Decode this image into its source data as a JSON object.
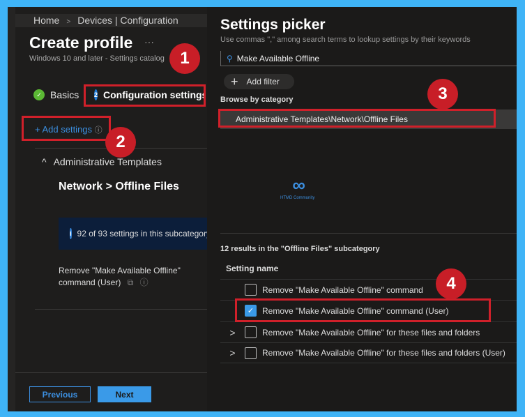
{
  "breadcrumb": [
    "Home",
    "Devices | Configuration"
  ],
  "title": "Create profile",
  "more": "···",
  "subtitle": "Windows 10 and later - Settings catalog",
  "steps": [
    {
      "num": "✓",
      "label": "Basics"
    },
    {
      "num": "2",
      "label": "Configuration settings"
    }
  ],
  "add_settings": "+ Add settings",
  "group": "Administrative Templates",
  "subcategory": "Network > Offline Files",
  "info": "92 of 93 settings in this subcategory",
  "setting_line1": "Remove \"Make Available Offline\"",
  "setting_line2": "command (User)",
  "buttons": {
    "previous": "Previous",
    "next": "Next"
  },
  "picker": {
    "title": "Settings picker",
    "hint": "Use commas \",\" among search terms to lookup settings by their keywords",
    "search_value": "Make Available Offline",
    "add_filter": "Add filter",
    "browse": "Browse by category",
    "category": "Administrative Templates\\Network\\Offline Files",
    "results": "12 results in the \"Offline Files\" subcategory",
    "column": "Setting name",
    "rows": [
      {
        "label": "Remove \"Make Available Offline\" command",
        "checked": false
      },
      {
        "label": "Remove \"Make Available Offline\" command (User)",
        "checked": true
      },
      {
        "label": "Remove \"Make Available Offline\" for these files and folders",
        "checked": false
      },
      {
        "label": "Remove \"Make Available Offline\" for these files and folders (User)",
        "checked": false
      }
    ]
  },
  "watermark": "HTMD Community",
  "callouts": [
    "1",
    "2",
    "3",
    "4"
  ],
  "colors": {
    "accent": "#3a9ae8",
    "callout": "#c81e27",
    "border": "#3fb4f7"
  }
}
